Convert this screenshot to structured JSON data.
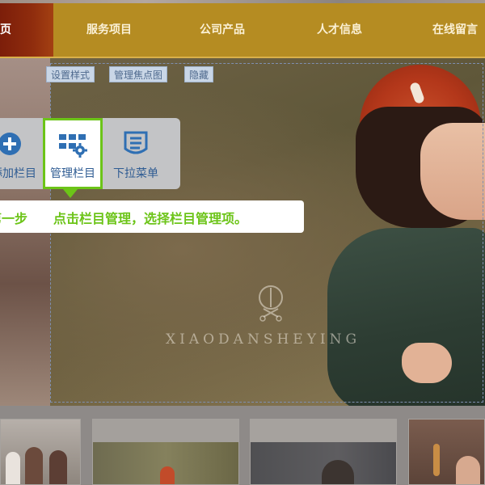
{
  "nav": {
    "items": [
      {
        "label": "首页",
        "active": true
      },
      {
        "label": "服务项目",
        "active": false
      },
      {
        "label": "公司产品",
        "active": false
      },
      {
        "label": "人才信息",
        "active": false
      },
      {
        "label": "在线留言",
        "active": false
      }
    ],
    "colors": {
      "bar": "#b58c22",
      "active": "#8f2c0d"
    }
  },
  "banner_tools": {
    "set_style": "设置样式",
    "manage_focus_image": "管理焦点图",
    "hide": "隐藏"
  },
  "watermark": "XIAODANSHEYING",
  "panel": {
    "buttons": [
      {
        "label": "添加栏目",
        "icon": "plus-circle-icon",
        "selected": false
      },
      {
        "label": "管理栏目",
        "icon": "grid-gear-icon",
        "selected": true
      },
      {
        "label": "下拉菜单",
        "icon": "list-menu-icon",
        "selected": false
      }
    ],
    "accent": "#6cc418",
    "icon_color": "#2f6fb3"
  },
  "instruction": {
    "step": "第一步",
    "text": "点击栏目管理，选择栏目管理项。"
  },
  "thumbnails": [
    {
      "name": "thumb-family-photo"
    },
    {
      "name": "thumb-forest-child"
    },
    {
      "name": "thumb-dark-portrait"
    },
    {
      "name": "thumb-baby-portrait"
    }
  ]
}
